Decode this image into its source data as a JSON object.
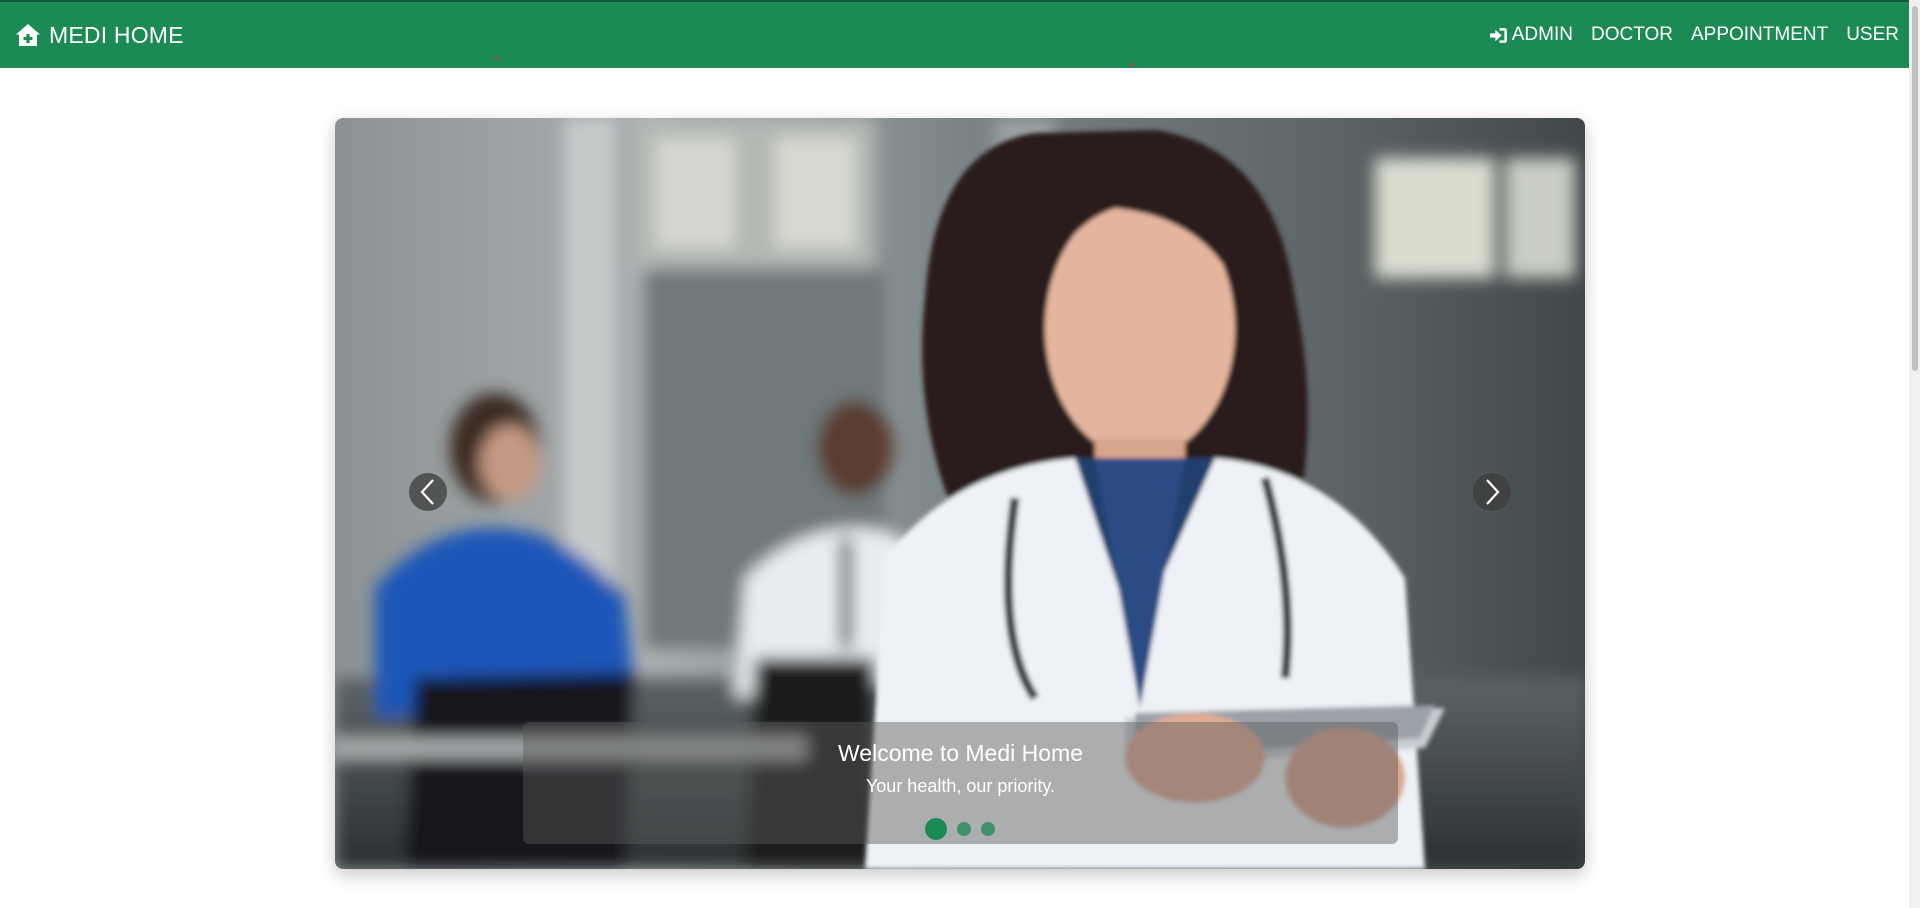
{
  "navbar": {
    "brand": "MEDI HOME",
    "brand_icon": "home-plus-icon",
    "links": [
      {
        "label": "ADMIN",
        "icon": "sign-in-icon"
      },
      {
        "label": "DOCTOR"
      },
      {
        "label": "APPOINTMENT"
      },
      {
        "label": "USER"
      }
    ]
  },
  "carousel": {
    "caption_title": "Welcome to Medi Home",
    "caption_subtitle": "Your health, our priority.",
    "slide_count": 3,
    "active_slide": 1,
    "image": "smiling female doctor in white coat holding tablet, colleagues in background"
  },
  "colors": {
    "navbar_bg": "#1b8a55",
    "accent": "#1b8a55"
  }
}
